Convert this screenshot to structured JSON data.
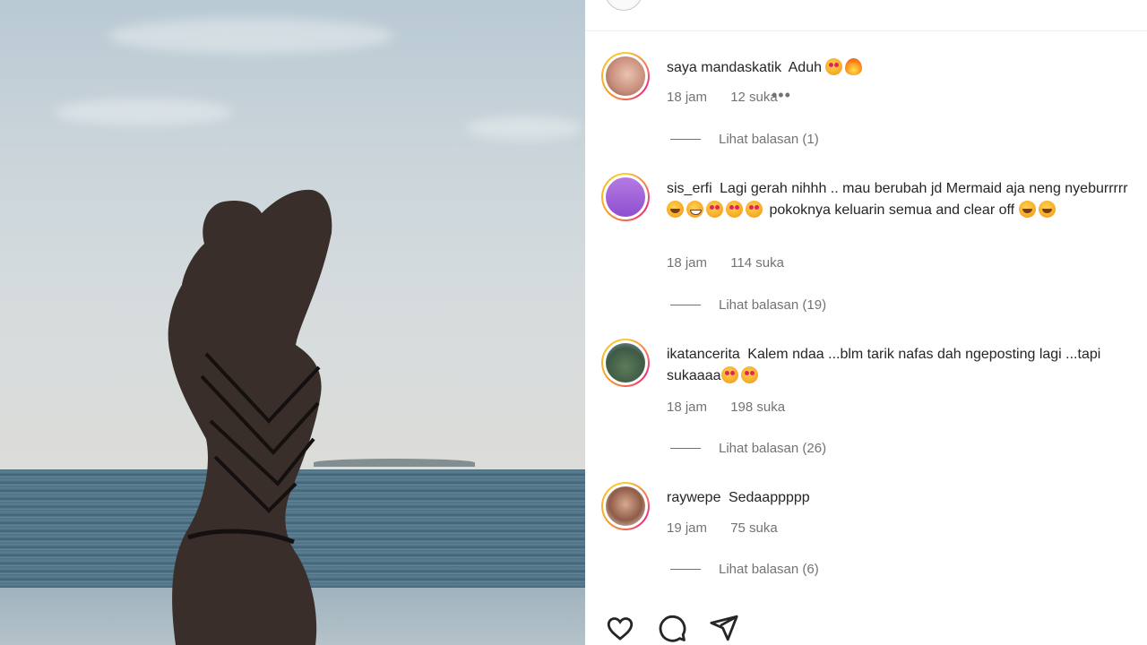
{
  "comments": [
    {
      "username": "saya mandaskatik",
      "text": "Aduh",
      "emojis": [
        "heart-eyes",
        "fire"
      ],
      "time": "18 jam",
      "likes": "12 suka",
      "more": "•••",
      "replies": "Lihat balasan (1)"
    },
    {
      "username": "sis_erfi",
      "text_1": "Lagi gerah nihhh .. mau berubah jd Mermaid aja neng nyeburrrrr",
      "text_2": "pokoknya keluarin semua and clear off",
      "emojis_1": [
        "rofl",
        "grin",
        "heart-eyes",
        "heart-eyes",
        "heart-eyes"
      ],
      "emojis_2": [
        "rofl",
        "rofl"
      ],
      "time": "18 jam",
      "likes": "114 suka",
      "replies": "Lihat balasan (19)"
    },
    {
      "username": "ikatancerita",
      "text": "Kalem ndaa ...blm tarik nafas dah ngeposting lagi ...tapi sukaaaa",
      "emojis": [
        "heart-eyes",
        "heart-eyes"
      ],
      "time": "18 jam",
      "likes": "198 suka",
      "replies": "Lihat balasan (26)"
    },
    {
      "username": "raywepe",
      "text": "Sedaappppp",
      "time": "19 jam",
      "likes": "75 suka",
      "replies": "Lihat balasan (6)"
    }
  ],
  "actions": [
    "heart-icon",
    "comment-icon",
    "share-icon"
  ],
  "colors": {
    "text": "#262626",
    "secondary": "#737373",
    "story_ring": "#ee2a7b"
  }
}
